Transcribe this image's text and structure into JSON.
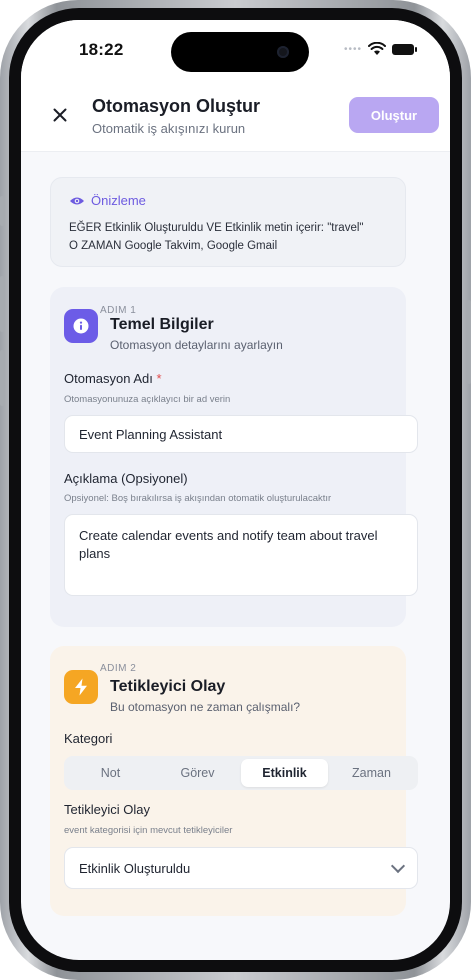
{
  "status": {
    "time": "18:22"
  },
  "header": {
    "title": "Otomasyon Oluştur",
    "subtitle": "Otomatik iş akışınızı kurun",
    "create_label": "Oluştur"
  },
  "preview": {
    "title": "Önizleme",
    "line1": "EĞER Etkinlik Oluşturuldu VE Etkinlik metin içerir: \"travel\"",
    "line2": "O ZAMAN Google Takvim, Google Gmail"
  },
  "step1": {
    "step": "ADIM 1",
    "icon": "info-icon",
    "title": "Temel Bilgiler",
    "subtitle": "Otomasyon detaylarını ayarlayın",
    "name_label": "Otomasyon Adı",
    "name_required": "*",
    "name_help": "Otomasyonunuza açıklayıcı bir ad verin",
    "name_value": "Event Planning Assistant",
    "desc_label": "Açıklama (Opsiyonel)",
    "desc_help": "Opsiyonel: Boş bırakılırsa iş akışından otomatik oluşturulacaktır",
    "desc_value": "Create calendar events and notify team about travel plans"
  },
  "step2": {
    "step": "ADIM 2",
    "icon": "lightning-icon",
    "title": "Tetikleyici Olay",
    "subtitle": "Bu otomasyon ne zaman çalışmalı?",
    "category_label": "Kategori",
    "categories": [
      "Not",
      "Görev",
      "Etkinlik",
      "Zaman"
    ],
    "selected_category": "Etkinlik",
    "trigger_label": "Tetikleyici Olay",
    "trigger_help": "event kategorisi için mevcut tetikleyiciler",
    "trigger_value": "Etkinlik Oluşturuldu"
  },
  "colors": {
    "accent": "#6d5be0",
    "create_button": "#b9a7f2",
    "step1_icon": "#6c5ce7",
    "step2_icon": "#f5a623"
  }
}
